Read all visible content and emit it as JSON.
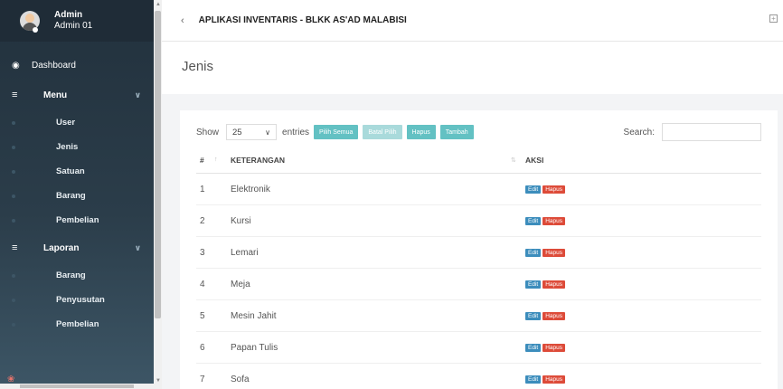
{
  "app": {
    "title": "APLIKASI INVENTARIS - BLKK AS'AD MALABISI"
  },
  "user": {
    "name": "Admin",
    "role": "Admin 01"
  },
  "sidebar": {
    "dashboard": "Dashboard",
    "menu_group": "Menu",
    "menu_items": [
      "User",
      "Jenis",
      "Satuan",
      "Barang",
      "Pembelian"
    ],
    "laporan_group": "Laporan",
    "laporan_items": [
      "Barang",
      "Penyusutan",
      "Pembelian"
    ]
  },
  "page": {
    "title": "Jenis"
  },
  "controls": {
    "show_label": "Show",
    "entries_value": "25",
    "entries_label": "entries",
    "btn_pilih_semua": "Pilih Semua",
    "btn_batal_pilih": "Batal Pilih",
    "btn_hapus": "Hapus",
    "btn_tambah": "Tambah",
    "search_label": "Search:"
  },
  "table": {
    "headers": {
      "no": "#",
      "keterangan": "KETERANGAN",
      "aksi": "AKSI"
    },
    "action_edit": "Edit",
    "action_hapus": "Hapus",
    "rows": [
      {
        "no": "1",
        "keterangan": "Elektronik"
      },
      {
        "no": "2",
        "keterangan": "Kursi"
      },
      {
        "no": "3",
        "keterangan": "Lemari"
      },
      {
        "no": "4",
        "keterangan": "Meja"
      },
      {
        "no": "5",
        "keterangan": "Mesin Jahit"
      },
      {
        "no": "6",
        "keterangan": "Papan Tulis"
      },
      {
        "no": "7",
        "keterangan": "Sofa"
      }
    ]
  }
}
